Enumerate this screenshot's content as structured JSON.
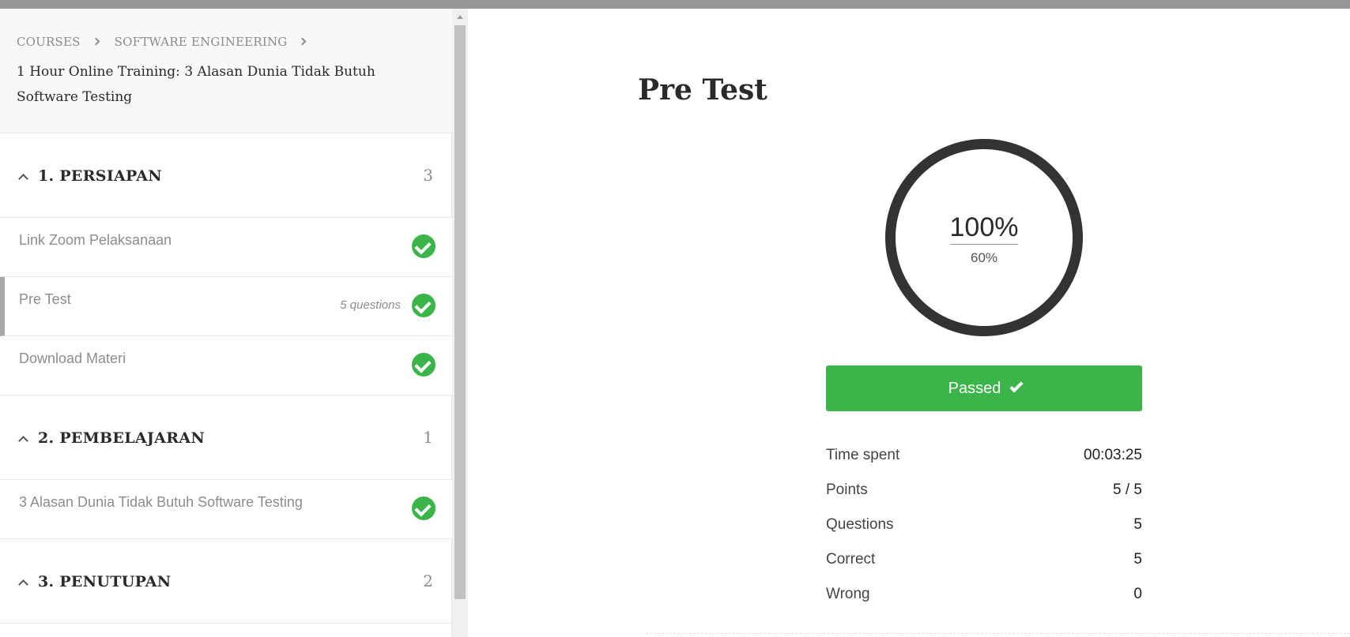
{
  "breadcrumb": {
    "items": [
      "COURSES",
      "SOFTWARE ENGINEERING"
    ]
  },
  "course": {
    "title": "1 Hour Online Training: 3 Alasan Dunia Tidak Butuh Software Testing"
  },
  "sections": [
    {
      "title": "1. PERSIAPAN",
      "count": "3",
      "items": [
        {
          "label": "Link Zoom Pelaksanaan",
          "meta": "",
          "completed": true
        },
        {
          "label": "Pre Test",
          "meta": "5 questions",
          "completed": true,
          "active": true
        },
        {
          "label": "Download Materi",
          "meta": "",
          "completed": true
        }
      ]
    },
    {
      "title": "2. PEMBELAJARAN",
      "count": "1",
      "items": [
        {
          "label": "3 Alasan Dunia Tidak Butuh Software Testing",
          "meta": "",
          "completed": true
        }
      ]
    },
    {
      "title": "3. PENUTUPAN",
      "count": "2",
      "items": []
    }
  ],
  "quiz": {
    "title": "Pre Test",
    "result_percent": "100%",
    "passing_percent": "60%",
    "status_label": "Passed",
    "stats": [
      {
        "label": "Time spent",
        "value": "00:03:25"
      },
      {
        "label": "Points",
        "value": "5 / 5"
      },
      {
        "label": "Questions",
        "value": "5"
      },
      {
        "label": "Correct",
        "value": "5"
      },
      {
        "label": "Wrong",
        "value": "0"
      }
    ]
  },
  "colors": {
    "success": "#3bb54a",
    "ring": "#333333",
    "topbar": "#979797"
  }
}
